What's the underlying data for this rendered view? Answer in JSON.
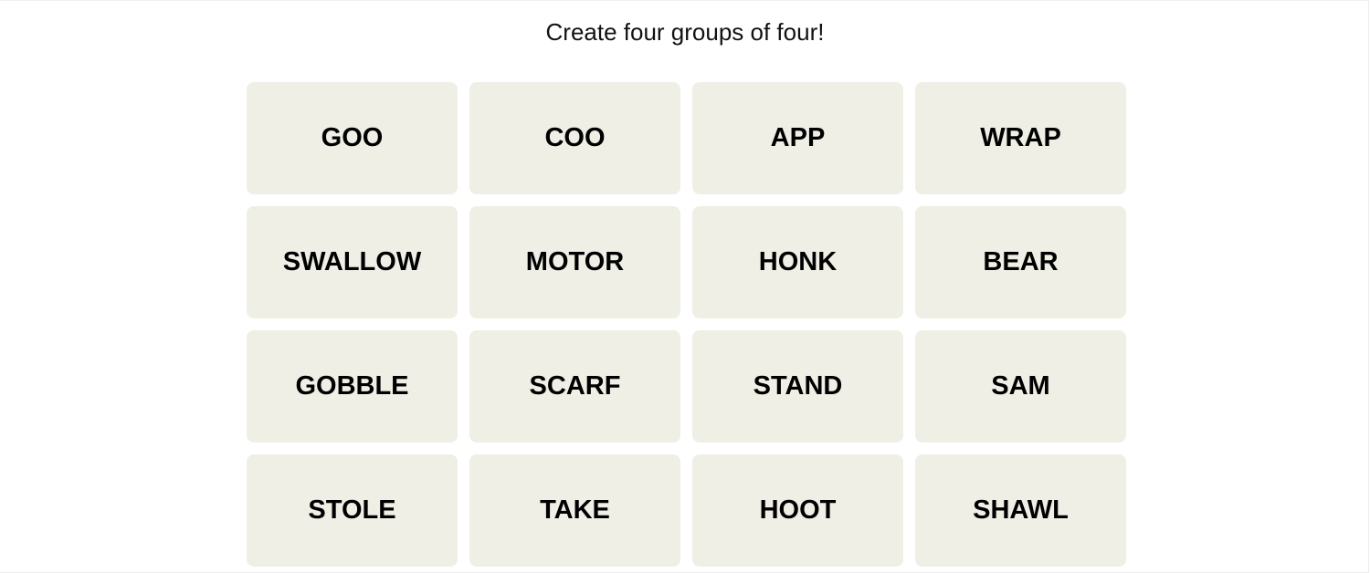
{
  "header": {
    "subtitle": "Create four groups of four!"
  },
  "colors": {
    "tile_background": "#efefe6",
    "text": "#000000"
  },
  "board": {
    "tiles": [
      {
        "label": "GOO"
      },
      {
        "label": "COO"
      },
      {
        "label": "APP"
      },
      {
        "label": "WRAP"
      },
      {
        "label": "SWALLOW"
      },
      {
        "label": "MOTOR"
      },
      {
        "label": "HONK"
      },
      {
        "label": "BEAR"
      },
      {
        "label": "GOBBLE"
      },
      {
        "label": "SCARF"
      },
      {
        "label": "STAND"
      },
      {
        "label": "SAM"
      },
      {
        "label": "STOLE"
      },
      {
        "label": "TAKE"
      },
      {
        "label": "HOOT"
      },
      {
        "label": "SHAWL"
      }
    ]
  }
}
